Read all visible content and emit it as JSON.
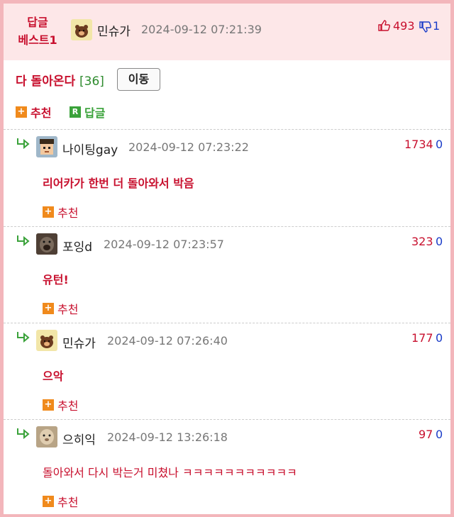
{
  "best": {
    "label_line1": "답글",
    "label_line2": "베스트1",
    "author": "민슈가",
    "date": "2024-09-12 07:21:39",
    "up": "493",
    "down": "1"
  },
  "parent": {
    "text": "다 돌아온다",
    "count": "[36]",
    "move_label": "이동",
    "recommend_label": "추천",
    "reply_label": "답글"
  },
  "replies": [
    {
      "author": "나이팅gay",
      "date": "2024-09-12 07:23:22",
      "up": "1734",
      "down": "0",
      "text": "리어카가 한번 더 돌아와서 박음",
      "recommend_label": "추천"
    },
    {
      "author": "포잉d",
      "date": "2024-09-12 07:23:57",
      "up": "323",
      "down": "0",
      "text": "유턴!",
      "recommend_label": "추천"
    },
    {
      "author": "민슈가",
      "date": "2024-09-12 07:26:40",
      "up": "177",
      "down": "0",
      "text": "으악",
      "recommend_label": "추천"
    },
    {
      "author": "으히익",
      "date": "2024-09-12 13:26:18",
      "up": "97",
      "down": "0",
      "text": "돌아와서 다시 박는거 미쳤나 ㅋㅋㅋㅋㅋㅋㅋㅋㅋㅋㅋ",
      "recommend_label": "추천"
    }
  ],
  "icons": {
    "plus": "+",
    "reply_marker": "R",
    "reply_arrow": "↳"
  },
  "colors": {
    "accent_red": "#c8102e",
    "accent_green": "#3aa23a",
    "accent_orange": "#f08a1c",
    "header_bg": "#fde7e8",
    "border_pink": "#f3b6bb"
  }
}
